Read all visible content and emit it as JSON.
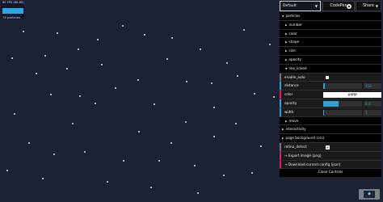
{
  "stats": {
    "fps_text": "60 FPS (60-60)",
    "particle_count": "78 particles"
  },
  "topbar": {
    "preset_selected": "Default",
    "codepen_label": "CodePen",
    "share_label": "Share",
    "icon_codepen": "codepen-icon"
  },
  "gui": {
    "particles": "particles",
    "number": "number",
    "color": "color",
    "shape": "shape",
    "size": "size",
    "opacity": "opacity",
    "line_linked": "line_linked",
    "enable_auto": "enable_auto",
    "distance_label": "distance",
    "distance_value": "150",
    "distance_level": 0.05,
    "color_label": "color",
    "color_value": "#ffffff",
    "opacity_label": "opacity",
    "opacity_value": "0.4",
    "opacity_level": 0.4,
    "width_label": "width",
    "width_value": "1",
    "width_level": 0.03,
    "move": "move",
    "interactivity": "interactivity",
    "page_background": "page background (css)",
    "retina_detect": "retina_detect",
    "export_image": "Export image (png)",
    "download_config": "Download current config (json)",
    "close_controls": "Close Controls"
  },
  "colors": {
    "background": "#1a2234",
    "accent": "#2fa1d6",
    "panel": "#1a1a1a"
  },
  "badge": {
    "label": "◆"
  }
}
